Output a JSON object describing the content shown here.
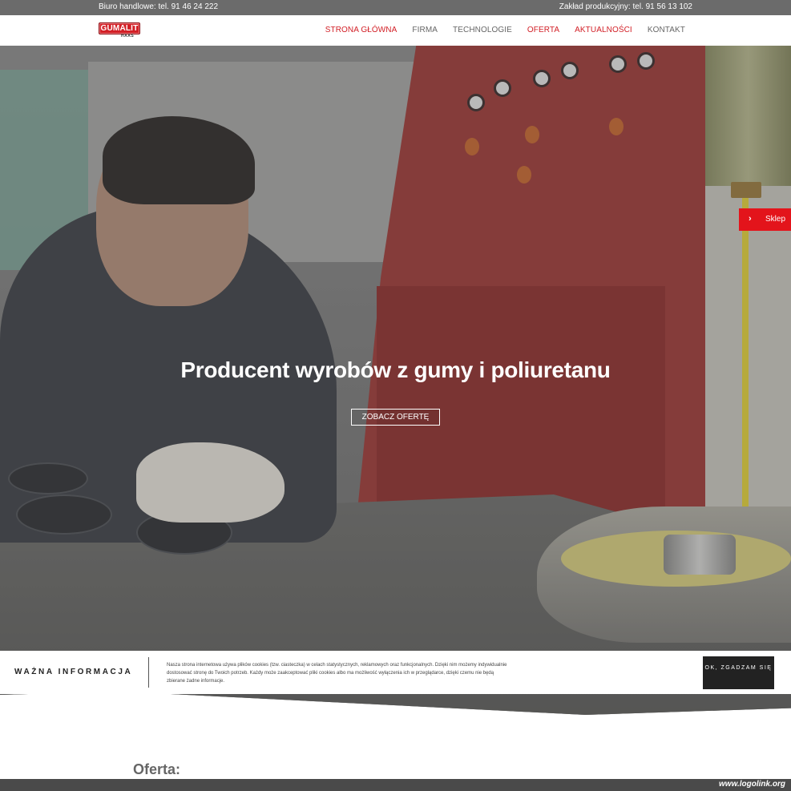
{
  "topbar": {
    "office_phone": "Biuro handlowe: tel. 91 46 24 222",
    "plant_phone": "Zakład produkcyjny: tel. 91 56 13 102"
  },
  "header": {
    "logo_text": "GUMALIT",
    "logo_sub": "HAAS",
    "nav": [
      {
        "label": "STRONA GŁÓWNA",
        "color": "#d21f26"
      },
      {
        "label": "FIRMA",
        "color": "#666666"
      },
      {
        "label": "TECHNOLOGIE",
        "color": "#666666"
      },
      {
        "label": "OFERTA",
        "color": "#d21f26"
      },
      {
        "label": "AKTUALNOŚCI",
        "color": "#d21f26"
      },
      {
        "label": "KONTAKT",
        "color": "#666666"
      }
    ]
  },
  "hero": {
    "title": "Producent wyrobów z gumy i poliuretanu",
    "button_label": "ZOBACZ OFERTĘ"
  },
  "shop_tab": {
    "icon": "chevron-right-icon",
    "label": "Sklep"
  },
  "cookie": {
    "title": "WAŻNA INFORMACJA",
    "text": "Nasza strona internetowa używa plików cookies (tzw. ciasteczka) w celach statystycznych, reklamowych oraz funkcjonalnych. Dzięki nim możemy indywidualnie dostosować stronę do Twoich potrzeb. Każdy może zaakceptować pliki cookies albo ma możliwość wyłączenia ich w przeglądarce, dzięki czemu nie będą zbierane żadne informacje.",
    "accept_label": "OK, ZGADZAM SIĘ"
  },
  "section": {
    "title": "Oferta:"
  },
  "watermark": "www.logolink.org",
  "colors": {
    "accent_red": "#e3141b",
    "topbar": "#6b6b6b",
    "cookie_button": "#222222"
  }
}
